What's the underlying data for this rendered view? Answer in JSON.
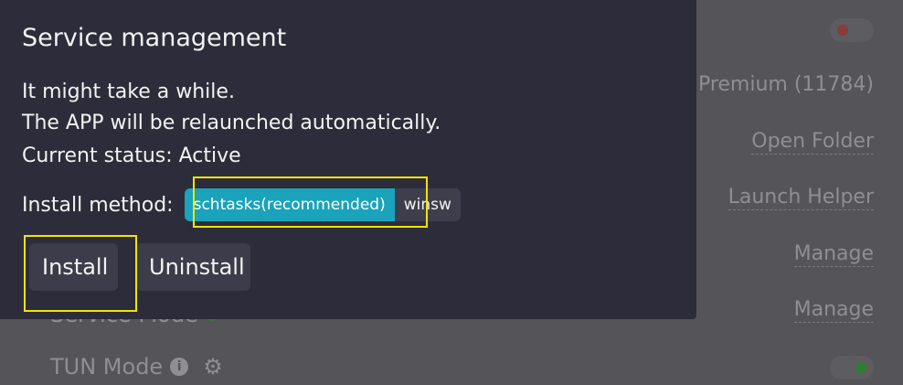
{
  "background": {
    "right_items": [
      {
        "label": "Premium (11784)"
      },
      {
        "label": "Open Folder"
      },
      {
        "label": "Launch Helper"
      },
      {
        "label": "Manage"
      },
      {
        "label": "Manage"
      }
    ],
    "left_items": [
      {
        "label": "Service Mode"
      },
      {
        "label": "TUN Mode"
      }
    ]
  },
  "modal": {
    "title": "Service management",
    "line1": "It might take a while.",
    "line2": "The APP will be relaunched automatically.",
    "status": "Current status: Active",
    "method_label": "Install method:",
    "methods": [
      "schtasks(recommended)",
      "winsw"
    ],
    "install_label": "Install",
    "uninstall_label": "Uninstall"
  },
  "colors": {
    "accent": "#1aa3ba",
    "highlight": "#f1e500",
    "modal_bg": "#2d2c3a"
  }
}
